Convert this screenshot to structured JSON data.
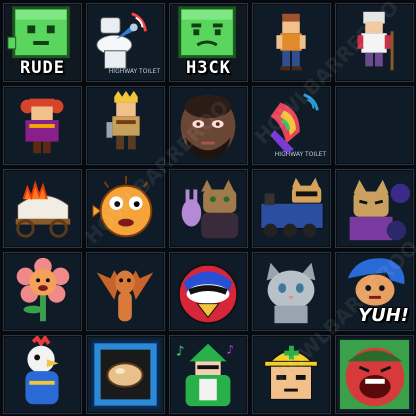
{
  "grid": {
    "tiles": [
      {
        "id": "t01",
        "caption": "RUDE",
        "icon": "green-cube-face"
      },
      {
        "id": "t02",
        "caption": "",
        "label": "HIGHWAY TOILET",
        "icon": "toilet-robot"
      },
      {
        "id": "t03",
        "caption": "H3CK",
        "icon": "green-cube-face"
      },
      {
        "id": "t04",
        "caption": "",
        "icon": "pixel-adventurer"
      },
      {
        "id": "t05",
        "caption": "",
        "icon": "pixel-old-man"
      },
      {
        "id": "t06",
        "caption": "",
        "icon": "pixel-redhead-girl"
      },
      {
        "id": "t07",
        "caption": "",
        "icon": "pixel-crowned-hero"
      },
      {
        "id": "t08",
        "caption": "",
        "icon": "bearded-man"
      },
      {
        "id": "t09",
        "caption": "",
        "label": "HIGHWAY TOILET",
        "icon": "rainbow-horn"
      },
      {
        "id": "t10",
        "caption": "",
        "icon": "empty"
      },
      {
        "id": "t11",
        "caption": "",
        "icon": "covered-wagon-fire"
      },
      {
        "id": "t12",
        "caption": "",
        "icon": "pufferfish"
      },
      {
        "id": "t13",
        "caption": "",
        "icon": "cat-with-bunny"
      },
      {
        "id": "t14",
        "caption": "",
        "icon": "cat-on-train"
      },
      {
        "id": "t15",
        "caption": "",
        "icon": "cat-with-bomb"
      },
      {
        "id": "t16",
        "caption": "",
        "icon": "flower-creature"
      },
      {
        "id": "t17",
        "caption": "",
        "icon": "bat-creature"
      },
      {
        "id": "t18",
        "caption": "",
        "icon": "bird-robot"
      },
      {
        "id": "t19",
        "caption": "",
        "icon": "grey-cat"
      },
      {
        "id": "t20",
        "caption": "",
        "label": "YUH!",
        "icon": "blue-hair-cat"
      },
      {
        "id": "t21",
        "caption": "",
        "icon": "rooster-wrestler"
      },
      {
        "id": "t22",
        "caption": "",
        "icon": "egg-item-box"
      },
      {
        "id": "t23",
        "caption": "",
        "icon": "green-armored-hero"
      },
      {
        "id": "t24",
        "caption": "",
        "icon": "hardhat-worker"
      },
      {
        "id": "t25",
        "caption": "",
        "icon": "yelling-man"
      }
    ]
  },
  "watermark": {
    "text": "HOWLBARREROO"
  },
  "colors": {
    "background": "#0b0f14",
    "tile": "#101820",
    "tile_border": "#2a3644",
    "slime_green": "#4fd35a",
    "text": "#ffffff"
  }
}
